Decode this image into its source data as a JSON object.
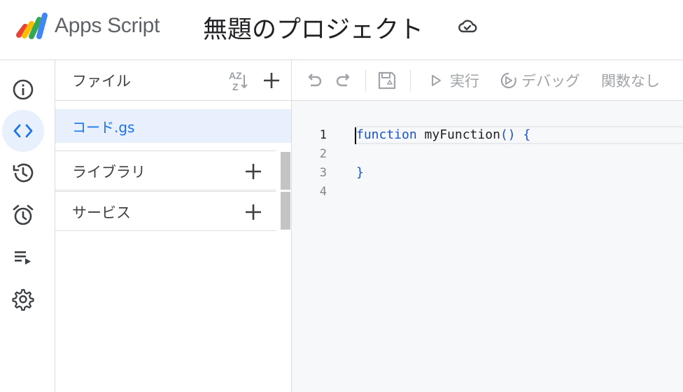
{
  "header": {
    "app_name": "Apps Script",
    "project_title": "無題のプロジェクト",
    "status_icon": "cloud-check-icon"
  },
  "rail": {
    "items": [
      {
        "name": "overview",
        "icon": "info-icon"
      },
      {
        "name": "editor",
        "icon": "code-icon",
        "active": true
      },
      {
        "name": "executions",
        "icon": "history-icon"
      },
      {
        "name": "triggers",
        "icon": "alarm-icon"
      },
      {
        "name": "executions-log",
        "icon": "playlist-icon"
      },
      {
        "name": "settings",
        "icon": "gear-icon"
      }
    ]
  },
  "files": {
    "title": "ファイル",
    "items": [
      {
        "name": "コード.gs",
        "selected": true
      }
    ],
    "sections": [
      {
        "label": "ライブラリ"
      },
      {
        "label": "サービス"
      }
    ]
  },
  "toolbar": {
    "run_label": "実行",
    "debug_label": "デバッグ",
    "function_select": "関数なし"
  },
  "editor": {
    "line_numbers": [
      "1",
      "2",
      "3",
      "4"
    ],
    "lines": [
      {
        "keyword": "function",
        "rest": " myFunction",
        "tail": "() {"
      },
      {
        "text": ""
      },
      {
        "text": "}"
      },
      {
        "text": ""
      }
    ]
  },
  "colors": {
    "accent": "#1a73e8",
    "active_bg": "#e8f0fe",
    "editor_bg": "#f7f8fa",
    "keyword": "#1a53c5"
  }
}
